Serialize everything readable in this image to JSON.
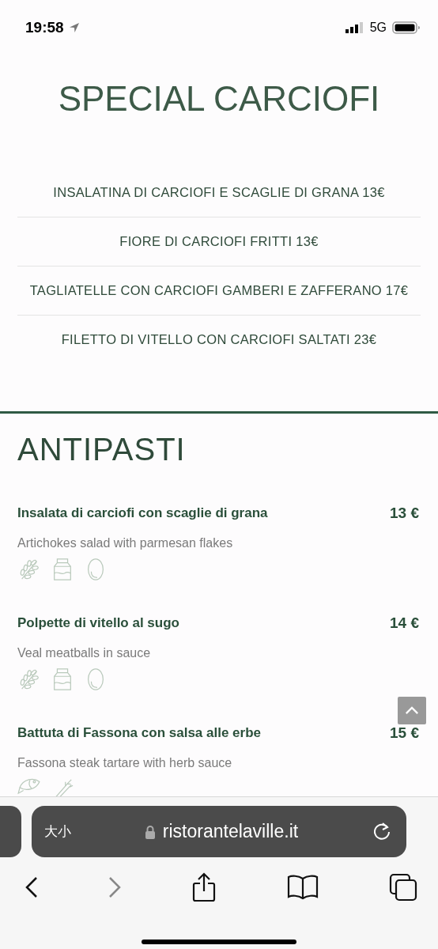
{
  "status_bar": {
    "time": "19:58",
    "network": "5G"
  },
  "specials": {
    "title": "SPECIAL CARCIOFI",
    "items": [
      {
        "text": "INSALATINA DI CARCIOFI E SCAGLIE DI GRANA 13€"
      },
      {
        "text": "FIORE DI CARCIOFI FRITTI 13€"
      },
      {
        "text": "TAGLIATELLE CON CARCIOFI GAMBERI E ZAFFERANO 17€"
      },
      {
        "text": "FILETTO DI VITELLO CON CARCIOFI SALTATI 23€"
      }
    ]
  },
  "section": {
    "title": "ANTIPASTI",
    "dishes": [
      {
        "name": "Insalata di carciofi con scaglie di grana",
        "price": "13 €",
        "description": "Artichokes salad with parmesan flakes",
        "allergens": [
          {
            "kind": "wheat"
          },
          {
            "kind": "milk"
          },
          {
            "kind": "egg"
          }
        ]
      },
      {
        "name": "Polpette di vitello al sugo",
        "price": "14 €",
        "description": "Veal meatballs in sauce",
        "allergens": [
          {
            "kind": "wheat"
          },
          {
            "kind": "milk"
          },
          {
            "kind": "egg"
          }
        ]
      },
      {
        "name": "Battuta di Fassona con salsa alle erbe",
        "price": "15 €",
        "description": "Fassona steak tartare with herb sauce",
        "allergens": [
          {
            "kind": "fish"
          },
          {
            "kind": "stalk"
          }
        ]
      }
    ]
  },
  "browser": {
    "text_size_label": "大小",
    "url": "ristorantelaville.it",
    "back_disabled": false,
    "forward_disabled": true
  }
}
